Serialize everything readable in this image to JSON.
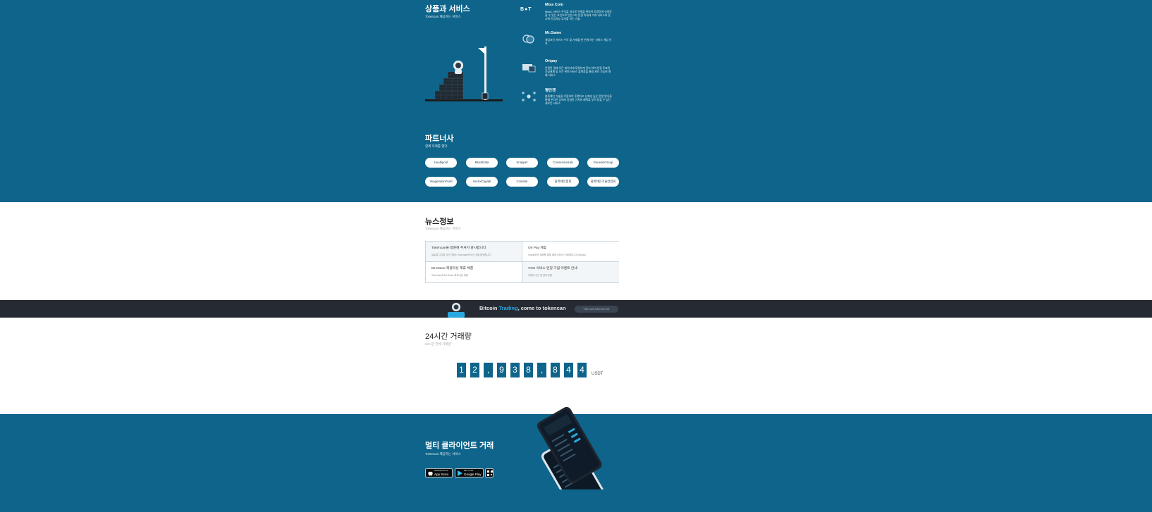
{
  "products_section": {
    "title": "상품과 서비스",
    "subtitle": "Tokencan 제공하는 서비스",
    "items": [
      {
        "name": "Miss Coin",
        "icon": "bot-logo-icon",
        "icon_text": "B●T",
        "description": "MissC 서비스 주식을 하나로 연결을 위하여 투명하게 신뢰받을 수 있는 코인으로 인한 2차 연결 차세대 거래 서비스와 동시에 인공지능 투자를 하는 기술"
      },
      {
        "name": "Mr.Game",
        "icon": "game-coins-icon",
        "description": "게임코인 서비스 수익 및 거래를 한 번에 하는 서비스 게임 유저"
      },
      {
        "name": "Oripay",
        "icon": "payment-device-icon",
        "description": "연결된 결제 모든 데이터에 투명하게 관리 하여 현장 투표된 지급결제 및 모든 관련 서비스 플랫폼을 통합 관리 가능한 결제 서비스"
      },
      {
        "name": "평단켓",
        "icon": "network-nodes-icon",
        "description": "블록체인 기술을 이용하여 투명하고 신뢰성 높은 운영 방식을 통해 온라인 상에서 동일한 가치와 혜택을 부여 받을 수 있는 새로운 서비스"
      }
    ]
  },
  "partners_section": {
    "title": "파트너사",
    "subtitle": "함께 미래를 열다",
    "partners": [
      "Huobipool",
      "BlockData",
      "Snapper",
      "ConsensusLab",
      "GenesisGroup",
      "ImaginationFund",
      "VectorCapital",
      "Coinstar",
      "블록체인협회",
      "블록체인기술연합회"
    ]
  },
  "news_section": {
    "title": "뉴스정보",
    "subtitle": "Tokencan 제공하는 서비스",
    "items": [
      {
        "title": "Tokencan을 방문해 주셔서 감사합니다",
        "desc": "글로벌 디지털 자산 거래소 Tokencan에 오신 것을 환영합니다"
      },
      {
        "title": "Ori Pay 제휴",
        "desc": "Oripay와의 제휴를 통해 결제 서비스가 확대됩니다 (Oripay)"
      },
      {
        "title": "Mr.Game 퍼블리싱 제휴 체결",
        "desc": "Tokencan과 Mr.Game 파트너십 체결"
      },
      {
        "title": "VOS 서비스 런칭 기념 이벤트 안내",
        "desc": "이벤트 기간 및 참여 방법"
      }
    ]
  },
  "banner": {
    "text_pre": "Bitcoin ",
    "text_accent": "Trading",
    "text_post": ", come to tokencan",
    "pill": "Visit www.tokencan.net",
    "accent_color": "#29a8e0"
  },
  "volume_section": {
    "title": "24시간 거래량",
    "subtitle": "24시간 전체 거래량",
    "digits": [
      "1",
      "2",
      ",",
      "9",
      "3",
      "8",
      ",",
      "8",
      "4",
      "4"
    ],
    "unit": "USDT"
  },
  "mobile_section": {
    "title": "멀티 클라이언트 거래",
    "subtitle": "Tokencan 제공하는 서비스",
    "app_store": {
      "small": "Download on the",
      "big": "App Store"
    },
    "google_play": {
      "small": "GET IT ON",
      "big": "Google Play"
    }
  },
  "colors": {
    "brand": "#0e648a",
    "banner_bg": "#262b33"
  }
}
